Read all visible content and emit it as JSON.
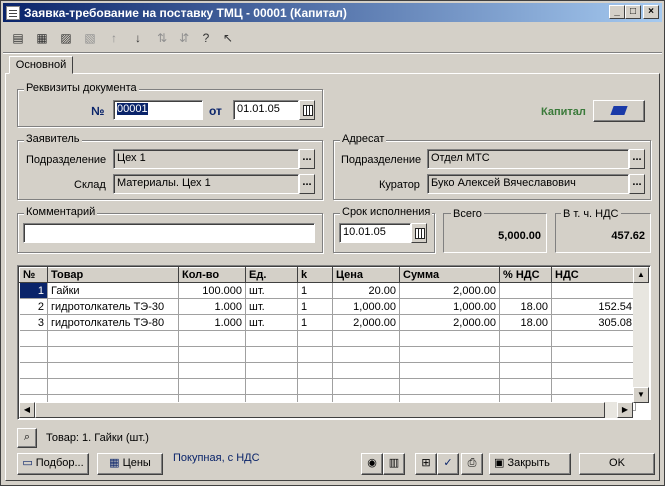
{
  "window": {
    "title": "Заявка-требование на поставку ТМЦ - 00001 (Капитал)",
    "min": "_",
    "max": "□",
    "close": "×"
  },
  "toolbar_icons": [
    "new-row-icon",
    "copy-row-icon",
    "delete-row-icon",
    "edit-row-icon",
    "move-up-icon",
    "move-down-icon",
    "sort-asc-icon",
    "sort-desc-icon",
    "help-icon",
    "context-help-icon"
  ],
  "tabs": [
    "Основной"
  ],
  "doc": {
    "group_label": "Реквизиты документа",
    "number_label": "№",
    "number": "00001",
    "from_label": "от",
    "date": "01.01.05",
    "firm_label": "Капитал"
  },
  "applicant": {
    "group_label": "Заявитель",
    "division_label": "Подразделение",
    "division": "Цех 1",
    "warehouse_label": "Склад",
    "warehouse": "Материалы. Цех 1"
  },
  "addressee": {
    "group_label": "Адресат",
    "division_label": "Подразделение",
    "division": "Отдел МТС",
    "curator_label": "Куратор",
    "curator": "Буко Алексей Вячеславович"
  },
  "comment": {
    "label": "Комментарий",
    "value": ""
  },
  "deadline": {
    "label": "Срок исполнения",
    "value": "10.01.05"
  },
  "totals": {
    "total_label": "Всего",
    "total": "5,000.00",
    "vat_label": "В т. ч. НДС",
    "vat": "457.62"
  },
  "table": {
    "columns": [
      "№",
      "Товар",
      "Кол-во",
      "Ед.",
      "k",
      "Цена",
      "Сумма",
      "% НДС",
      "НДС"
    ],
    "rows": [
      [
        "1",
        "Гайки",
        "100.000",
        "шт.",
        "1",
        "20.00",
        "2,000.00",
        "",
        ""
      ],
      [
        "2",
        "гидротолкатель ТЭ-30",
        "1.000",
        "шт.",
        "1",
        "1,000.00",
        "1,000.00",
        "18.00",
        "152.54"
      ],
      [
        "3",
        "гидротолкатель ТЭ-80",
        "1.000",
        "шт.",
        "1",
        "2,000.00",
        "2,000.00",
        "18.00",
        "305.08"
      ]
    ]
  },
  "status": {
    "text": "Товар: 1. Гайки (шт.)"
  },
  "footer": {
    "select_button": "Подбор...",
    "prices_button": "Цены",
    "price_type": "Покупная, с НДС",
    "close_button": "Закрыть",
    "ok_button": "OK"
  }
}
